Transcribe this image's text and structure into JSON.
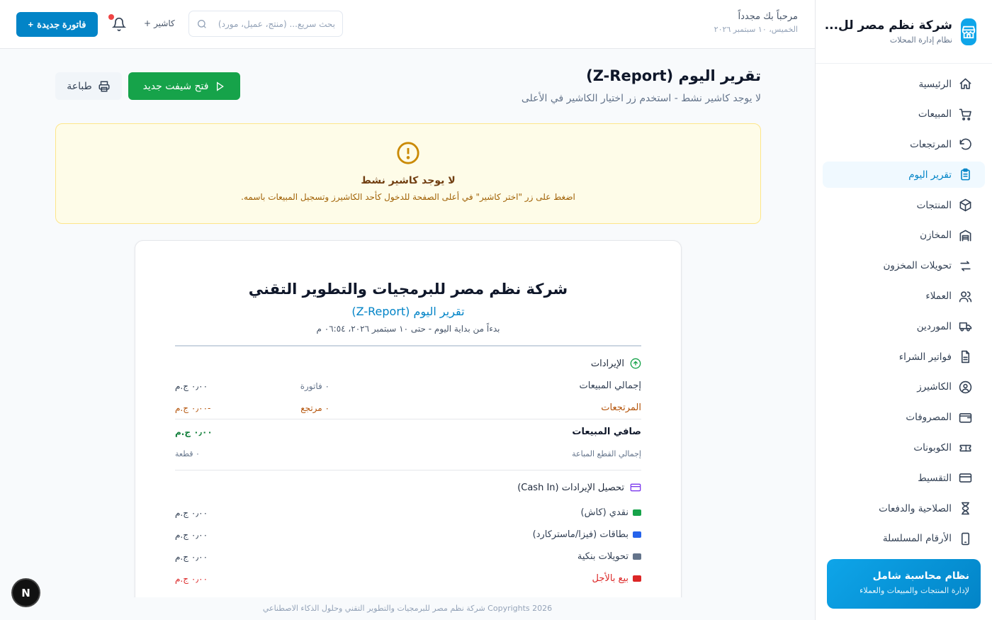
{
  "brand": {
    "name": "شركة نظم مصر لل...",
    "subtitle": "نظام إدارة المحلات",
    "icon": "store-icon"
  },
  "sidebar": {
    "items": [
      {
        "label": "الرئيسية",
        "icon": "home-icon",
        "active": false
      },
      {
        "label": "المبيعات",
        "icon": "cart-icon",
        "active": false
      },
      {
        "label": "المرتجعات",
        "icon": "undo-icon",
        "active": false
      },
      {
        "label": "تقرير اليوم",
        "icon": "clipboard-icon",
        "active": true
      },
      {
        "label": "المنتجات",
        "icon": "box-icon",
        "active": false
      },
      {
        "label": "المخازن",
        "icon": "warehouse-icon",
        "active": false
      },
      {
        "label": "تحويلات المخزون",
        "icon": "transfer-icon",
        "active": false
      },
      {
        "label": "العملاء",
        "icon": "users-icon",
        "active": false
      },
      {
        "label": "الموردين",
        "icon": "truck-icon",
        "active": false
      },
      {
        "label": "فواتير الشراء",
        "icon": "file-icon",
        "active": false
      },
      {
        "label": "الكاشيرز",
        "icon": "user-circle-icon",
        "active": false
      },
      {
        "label": "المصروفات",
        "icon": "wallet-icon",
        "active": false
      },
      {
        "label": "الكوبونات",
        "icon": "ticket-icon",
        "active": false
      },
      {
        "label": "التقسيط",
        "icon": "credit-card-icon",
        "active": false
      },
      {
        "label": "الصلاحية والدفعات",
        "icon": "hourglass-icon",
        "active": false
      },
      {
        "label": "الأرقام المسلسلة",
        "icon": "phone-icon",
        "active": false
      }
    ],
    "promo": {
      "title": "نظام محاسبة شامل",
      "subtitle": "لإدارة المنتجات والمبيعات والعملاء"
    }
  },
  "topbar": {
    "welcome": "مرحباً بك مجدداً",
    "date": "الخميس، ١٠ سبتمبر ٢٠٢٦",
    "search_placeholder": "بحث سريع... (منتج، عميل، مورد)",
    "cashier_label": "كاشير",
    "new_invoice_label": "فاتورة جديدة"
  },
  "page": {
    "title": "تقرير اليوم (Z-Report)",
    "subtitle": "لا يوجد كاشير نشط - استخدم زر اختيار الكاشير في الأعلى",
    "open_shift_label": "فتح شيفت جديد",
    "print_label": "طباعة"
  },
  "alert": {
    "title": "لا يوجد كاشير نشط",
    "text": "اضغط على زر \"اختر كاشير\" في أعلى الصفحة للدخول كأحد الكاشيرز وتسجيل المبيعات باسمه."
  },
  "report": {
    "company": "شركة نظم مصر للبرمجيات والتطوير التقني",
    "name": "تقرير اليوم (Z-Report)",
    "range": "بدءاً من بداية اليوم - حتى ١٠ سبتمبر ٢٠٢٦، ٠٦:٥٤ م",
    "revenue_title": "الإيرادات",
    "total_sales": {
      "label": "إجمالي المبيعات",
      "mid": "٠ فاتورة",
      "amount": "٠٫٠٠ ج.م"
    },
    "returns": {
      "label": "المرتجعات",
      "mid": "٠ مرتجع",
      "amount": "-٠٫٠٠ ج.م"
    },
    "net_sales": {
      "label": "صافي المبيعات",
      "amount": "٠٫٠٠ ج.م"
    },
    "items_sold": {
      "label": "إجمالي القطع المباعة",
      "amount": "٠ قطعة"
    },
    "cash_in_title": "تحصيل الإيرادات (Cash In)",
    "payments": [
      {
        "label": "نقدي (كاش)",
        "amount": "٠٫٠٠ ج.م",
        "color": "#16a34a"
      },
      {
        "label": "بطاقات (فيزا/ماستركارد)",
        "amount": "٠٫٠٠ ج.م",
        "color": "#2563eb"
      },
      {
        "label": "تحويلات بنكية",
        "amount": "٠٫٠٠ ج.م",
        "color": "#64748b"
      },
      {
        "label": "بيع بالأجل",
        "amount": "٠٫٠٠ ج.م",
        "color": "#dc2626"
      }
    ]
  },
  "footer": {
    "text": "Copyrights 2026 شركة نظم مصر للبرمجيات والتطوير التقني وحلول الذكاء الاصطناعي"
  },
  "dev_badge": {
    "label": "N"
  },
  "colors": {
    "accent": "#0284c7",
    "success": "#16a34a",
    "warning_bg": "#fefce8"
  }
}
